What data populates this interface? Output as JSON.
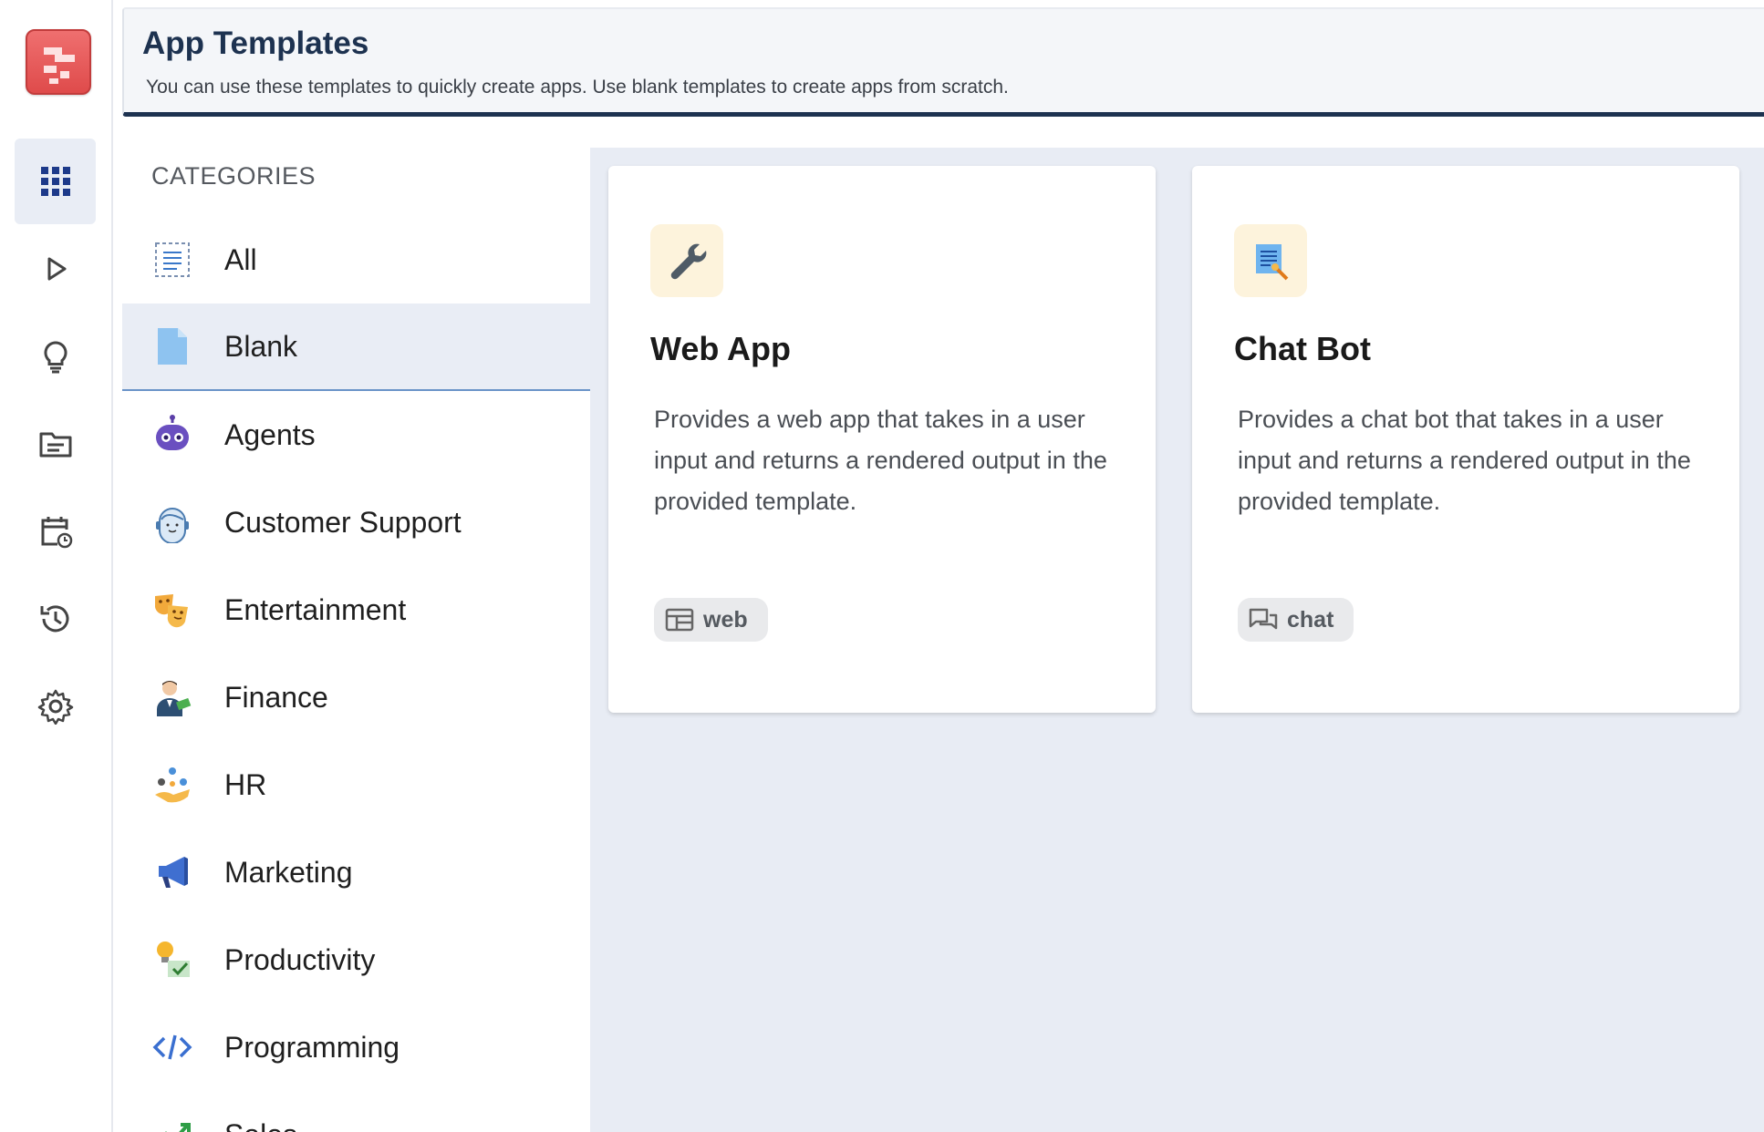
{
  "header": {
    "title": "App Templates",
    "subtitle": "You can use these templates to quickly create apps. Use blank templates to create apps from scratch."
  },
  "rail": {
    "items": [
      {
        "icon": "apps-grid-icon",
        "active": true
      },
      {
        "icon": "play-icon",
        "active": false
      },
      {
        "icon": "lightbulb-icon",
        "active": false
      },
      {
        "icon": "folder-icon",
        "active": false
      },
      {
        "icon": "calendar-history-icon",
        "active": false
      },
      {
        "icon": "history-icon",
        "active": false
      },
      {
        "icon": "settings-icon",
        "active": false
      }
    ]
  },
  "categories": {
    "title": "CATEGORIES",
    "selected": "Blank",
    "items": [
      {
        "label": "All",
        "icon": "list-icon"
      },
      {
        "label": "Blank",
        "icon": "blank-document-icon"
      },
      {
        "label": "Agents",
        "icon": "robot-icon"
      },
      {
        "label": "Customer Support",
        "icon": "headset-agent-icon"
      },
      {
        "label": "Entertainment",
        "icon": "theater-masks-icon"
      },
      {
        "label": "Finance",
        "icon": "finance-person-icon"
      },
      {
        "label": "HR",
        "icon": "hr-people-icon"
      },
      {
        "label": "Marketing",
        "icon": "megaphone-icon"
      },
      {
        "label": "Productivity",
        "icon": "productivity-icon"
      },
      {
        "label": "Programming",
        "icon": "code-icon"
      },
      {
        "label": "Sales",
        "icon": "sales-chart-icon"
      }
    ]
  },
  "cards": [
    {
      "title": "Web App",
      "description": "Provides a web app that takes in a user input and returns a rendered output in the provided template.",
      "icon": "wrench-icon",
      "tag": "web",
      "tag_icon": "web-layout-icon"
    },
    {
      "title": "Chat Bot",
      "description": "Provides a chat bot that takes in a user input and returns a rendered output in the provided template.",
      "icon": "document-search-icon",
      "tag": "chat",
      "tag_icon": "chat-bubbles-icon"
    }
  ],
  "colors": {
    "header_accent": "#1d3250",
    "logo": "#e25555",
    "content_bg": "#e8ecf4",
    "selected_bg": "#e9edf5"
  }
}
